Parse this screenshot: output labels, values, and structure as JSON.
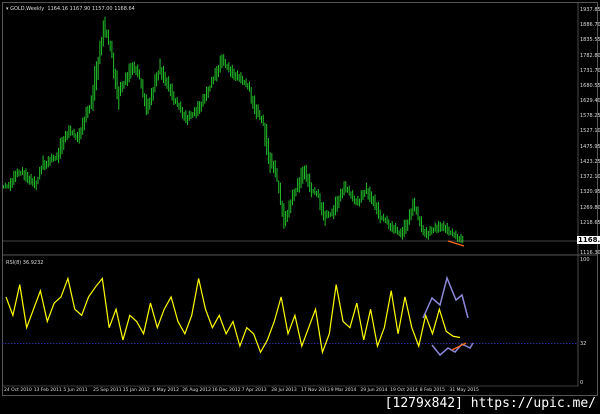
{
  "header": {
    "symbol": "GOLD,Weekly",
    "ohlc": "1164.16 1167.90 1157.00 1168.64"
  },
  "rsi_header": "RSI(8) 36.9232",
  "watermark": "[1279x842] https://upic.me/",
  "colors": {
    "bars": "#22c02a",
    "rsi": "#ffff00",
    "annotation": "#8c88d8",
    "arrow": "#ff6a1a",
    "level": "#3a3ad0"
  },
  "chart_data": [
    {
      "type": "bar",
      "subtype": "ohlc",
      "title": "GOLD,Weekly",
      "price_ticks": [
        "1937.85",
        "1886.70",
        "1835.55",
        "1782.80",
        "1731.70",
        "1680.55",
        "1629.40",
        "1578.25",
        "1527.10",
        "1475.95",
        "1423.25",
        "1372.10",
        "1320.95",
        "1269.80",
        "1218.65",
        "1116.30"
      ],
      "current_price": "1168.64",
      "ylim": [
        1116.3,
        1937.85
      ],
      "date_ticks": [
        "24 Oct 2010",
        "13 Feb 2011",
        "5 Jun 2011",
        "25 Sep 2011",
        "15 Jan 2012",
        "6 May 2012",
        "26 Aug 2012",
        "16 Dec 2012",
        "7 Apr 2013",
        "28 Jul 2013",
        "17 Nov 2013",
        "9 Mar 2014",
        "29 Jun 2014",
        "19 Oct 2014",
        "8 Feb 2015",
        "31 May 2015"
      ],
      "closes": [
        1340,
        1380,
        1390,
        1370,
        1345,
        1410,
        1430,
        1440,
        1500,
        1530,
        1500,
        1560,
        1620,
        1760,
        1880,
        1790,
        1650,
        1700,
        1750,
        1720,
        1600,
        1660,
        1740,
        1700,
        1640,
        1600,
        1570,
        1590,
        1620,
        1660,
        1710,
        1770,
        1740,
        1720,
        1700,
        1670,
        1600,
        1560,
        1440,
        1380,
        1220,
        1280,
        1340,
        1400,
        1330,
        1310,
        1240,
        1250,
        1300,
        1340,
        1300,
        1290,
        1330,
        1300,
        1240,
        1220,
        1200,
        1180,
        1220,
        1280,
        1200,
        1180,
        1200,
        1210,
        1190,
        1170,
        1165
      ]
    },
    {
      "type": "line",
      "title": "RSI(8) 36.9232",
      "ylim": [
        0,
        100
      ],
      "levels": [
        32
      ],
      "y_ticks": [
        "100",
        "32",
        "0"
      ],
      "values": [
        70,
        55,
        80,
        45,
        60,
        75,
        50,
        65,
        70,
        85,
        60,
        55,
        70,
        78,
        85,
        45,
        60,
        35,
        55,
        50,
        40,
        65,
        45,
        60,
        70,
        50,
        40,
        55,
        85,
        60,
        45,
        55,
        40,
        50,
        30,
        45,
        40,
        25,
        35,
        50,
        70,
        40,
        55,
        30,
        45,
        60,
        25,
        40,
        80,
        50,
        45,
        65,
        35,
        60,
        30,
        45,
        75,
        40,
        70,
        45,
        30,
        55,
        40,
        60,
        42,
        38,
        37
      ]
    }
  ]
}
